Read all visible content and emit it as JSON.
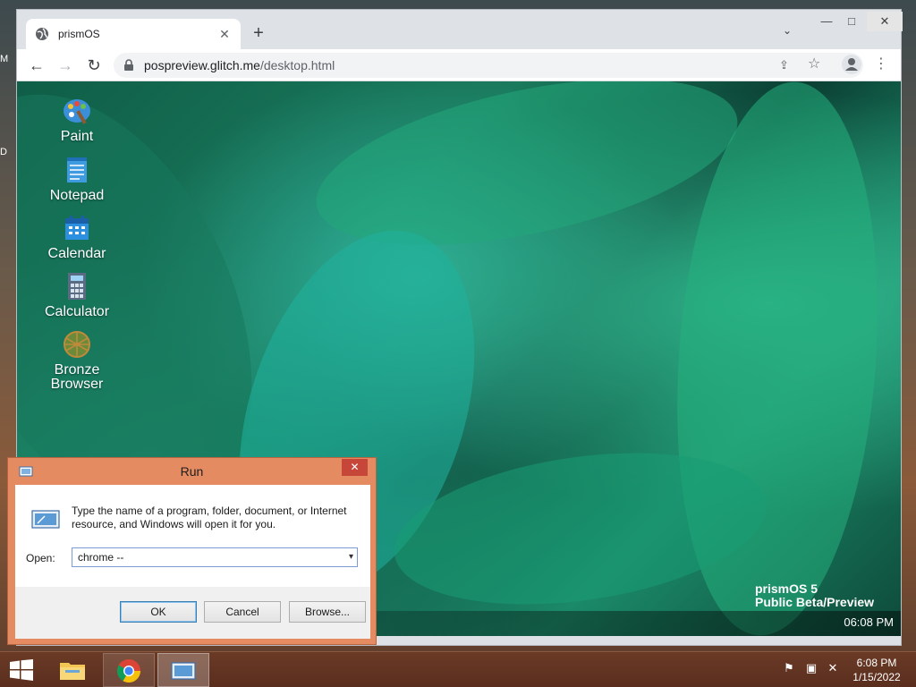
{
  "host_edge": {
    "top_letter": "M",
    "mid_letter": "D"
  },
  "browser": {
    "tab_title": "prismOS",
    "tab_close_glyph": "✕",
    "new_tab_glyph": "+",
    "tab_search_glyph": "⌄",
    "window_controls": {
      "minimize": "—",
      "maximize": "□",
      "close": "✕"
    },
    "nav": {
      "back": "←",
      "forward": "→",
      "reload": "↻"
    },
    "url_host": "pospreview.glitch.me",
    "url_path": "/desktop.html",
    "share_glyph": "⇪",
    "star_glyph": "☆",
    "menu_glyph": "⋮"
  },
  "prism": {
    "icons": [
      {
        "label": "Paint",
        "icon": "paint-palette-icon"
      },
      {
        "label": "Notepad",
        "icon": "notepad-icon"
      },
      {
        "label": "Calendar",
        "icon": "calendar-icon"
      },
      {
        "label": "Calculator",
        "icon": "calculator-icon"
      },
      {
        "label_line1": "Bronze",
        "label_line2": "Browser",
        "icon": "bronze-browser-icon"
      }
    ],
    "brand_line1": "prismOS 5",
    "brand_line2": "Public Beta/Preview",
    "clock": "06:08 PM"
  },
  "run_dialog": {
    "title": "Run",
    "close_glyph": "✕",
    "description": "Type the name of a program, folder, document, or Internet resource, and Windows will open it for you.",
    "open_label": "Open:",
    "open_value": "chrome --",
    "dropdown_glyph": "▾",
    "buttons": {
      "ok": "OK",
      "cancel": "Cancel",
      "browse": "Browse..."
    }
  },
  "taskbar": {
    "time": "6:08 PM",
    "date": "1/15/2022",
    "tray": {
      "flag": "⚑",
      "network": "▣",
      "volume": "✕"
    }
  },
  "colors": {
    "run_frame": "#e48b61",
    "run_close": "#c7463a",
    "taskbar": "#5a2e1e"
  }
}
